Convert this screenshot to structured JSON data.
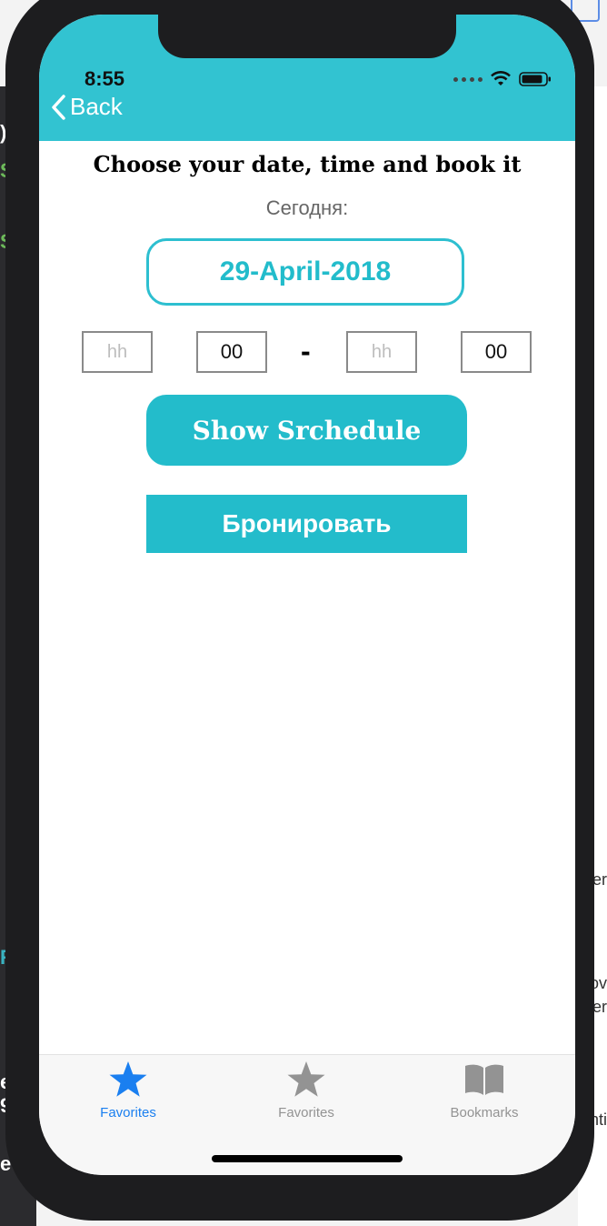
{
  "status_bar": {
    "time": "8:55"
  },
  "nav": {
    "back_label": "Back"
  },
  "content": {
    "heading": "Choose your date, time and book it",
    "today_label": "Сегодня:",
    "date_value": "29-April-2018",
    "time": {
      "start_hour_placeholder": "hh",
      "start_minute": "00",
      "separator": "-",
      "end_hour_placeholder": "hh",
      "end_minute": "00"
    },
    "show_schedule_label": "Show Srchedule",
    "book_label": "Бронировать"
  },
  "tabs": [
    {
      "label": "Favorites",
      "icon": "star-icon",
      "active": true
    },
    {
      "label": "Favorites",
      "icon": "star-icon",
      "active": false
    },
    {
      "label": "Bookmarks",
      "icon": "book-icon",
      "active": false
    }
  ],
  "colors": {
    "accent": "#32c3d1",
    "button": "#23bccb",
    "tab_active": "#1a7ff0",
    "tab_inactive": "#939393"
  },
  "background": {
    "left_fragments": [
      ")",
      "S",
      "S",
      "R",
      "e",
      "9",
      "e"
    ],
    "right_fragments": [
      "er",
      "ov",
      "er",
      "nti"
    ]
  }
}
